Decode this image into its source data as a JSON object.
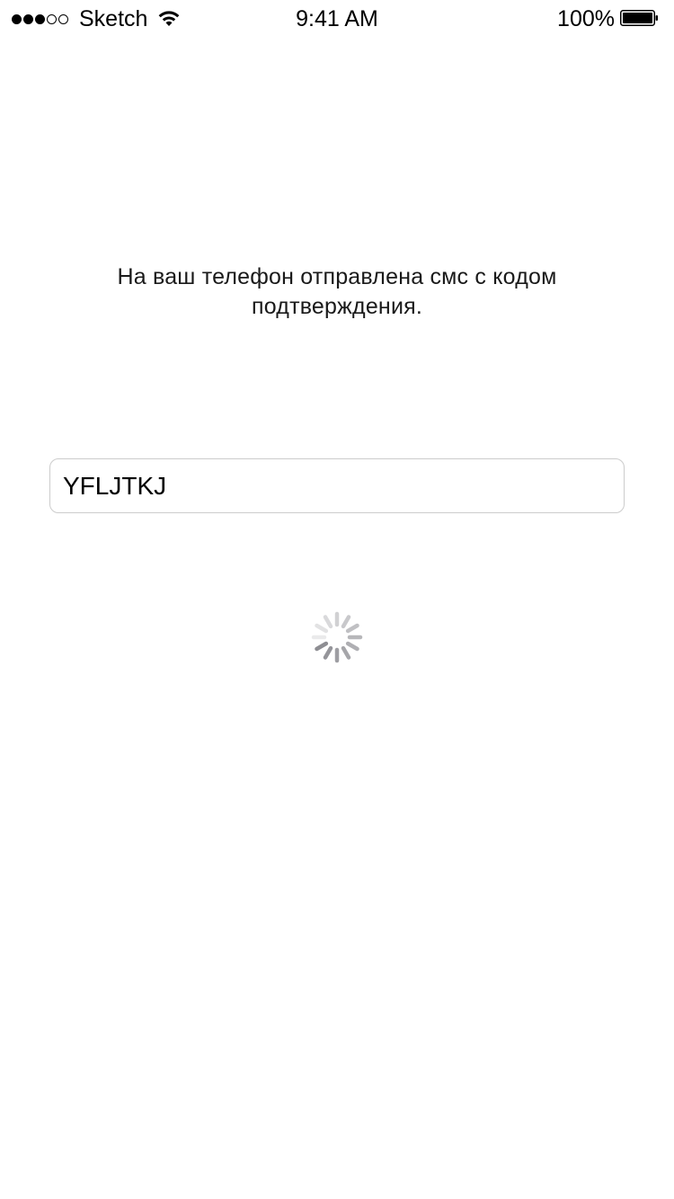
{
  "status_bar": {
    "carrier": "Sketch",
    "time": "9:41 AM",
    "battery_percent": "100%",
    "signal_bars_filled": 3,
    "signal_bars_total": 5,
    "wifi_icon": "wifi-icon",
    "battery_icon": "battery-full-icon"
  },
  "main": {
    "message": "На ваш телефон отправлена смс с кодом подтверждения.",
    "code_field": {
      "value": "YFLJTKJ",
      "placeholder": ""
    },
    "spinner_icon": "activity-spinner-icon"
  },
  "colors": {
    "background": "#ffffff",
    "input_border": "#cccccc",
    "spinner": "#8e8e93"
  }
}
